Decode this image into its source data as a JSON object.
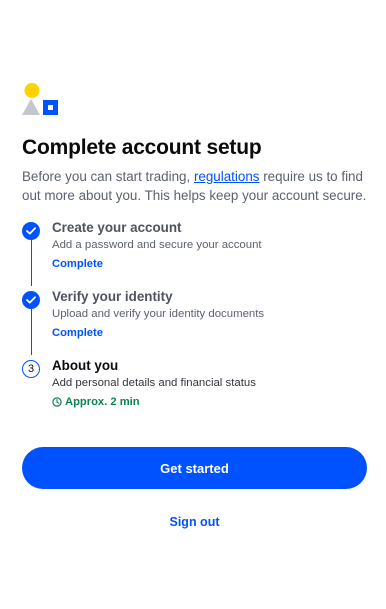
{
  "page": {
    "title": "Complete account setup",
    "intro_before": "Before you can start trading, ",
    "intro_link": "regulations",
    "intro_after": " require us to find out more about you. This helps keep your account secure."
  },
  "logo": {
    "icon": "identity-shapes-icon",
    "colors": {
      "circle": "#ffd200",
      "triangle": "#c3c6cc",
      "square": "#0052ff"
    }
  },
  "steps": [
    {
      "state": "complete",
      "icon": "check-icon",
      "title": "Create your account",
      "description": "Add a password and secure your account",
      "status": "Complete"
    },
    {
      "state": "complete",
      "icon": "check-icon",
      "title": "Verify your identity",
      "description": "Upload and verify your identity documents",
      "status": "Complete"
    },
    {
      "state": "current",
      "number": "3",
      "title": "About you",
      "description": "Add personal details and financial status",
      "time_icon": "clock-icon",
      "time": "Approx. 2 min"
    }
  ],
  "actions": {
    "primary_label": "Get started",
    "secondary_label": "Sign out"
  },
  "colors": {
    "accent": "#0052ff",
    "success": "#098551",
    "text_primary": "#0a0b0d",
    "text_secondary": "#5b616e"
  }
}
